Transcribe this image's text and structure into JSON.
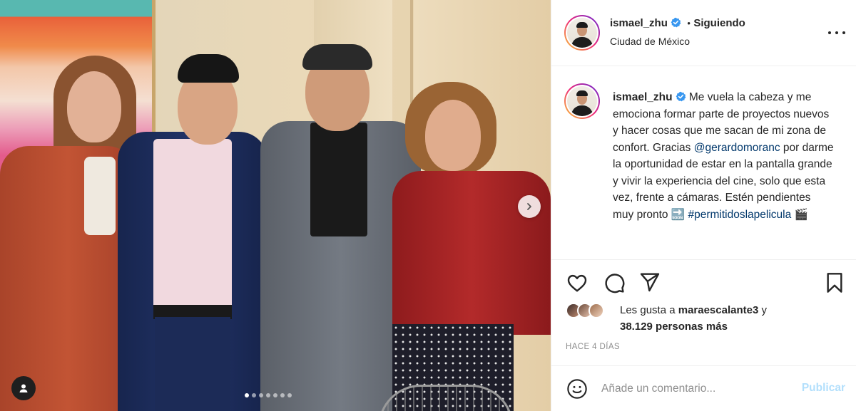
{
  "post": {
    "username": "ismael_zhu",
    "verified": true,
    "follow_separator": "•",
    "follow_status": "Siguiendo",
    "location": "Ciudad de México",
    "more_icon": "more-horizontal-icon"
  },
  "caption": {
    "username": "ismael_zhu",
    "text_before_mention": "Me vuela la cabeza y me emociona formar parte de proyectos nuevos y hacer cosas que me sacan de mi zona de confort. Gracias ",
    "mention": "@gerardomoranc",
    "text_after_mention": " por darme la oportunidad de estar en la pantalla grande y vivir la experiencia del cine, solo que esta vez, frente a cámaras. Estén pendientes muy pronto ",
    "soon_emoji": "🔜",
    "hashtag": "#permitidoslapelicula",
    "clapper_emoji": "🎬"
  },
  "actions": {
    "like_icon": "heart-icon",
    "comment_icon": "comment-icon",
    "share_icon": "paper-plane-icon",
    "save_icon": "bookmark-icon"
  },
  "likes": {
    "prefix": "Les gusta a",
    "first_liker": "maraescalante3",
    "connector": "y",
    "others": "38.129 personas más"
  },
  "date": "HACE 4 DÍAS",
  "comment": {
    "emoji_icon": "smiley-icon",
    "placeholder": "Añade un comentario...",
    "publish_label": "Publicar"
  },
  "carousel": {
    "slide_count": 7,
    "active_slide": 1,
    "next_icon": "chevron-right-icon",
    "tag_icon": "user-tag-icon"
  },
  "colors": {
    "verified_badge": "#3897f0",
    "link": "#00376b",
    "publish_disabled": "#b2dffc",
    "muted": "#8e8e8e"
  }
}
